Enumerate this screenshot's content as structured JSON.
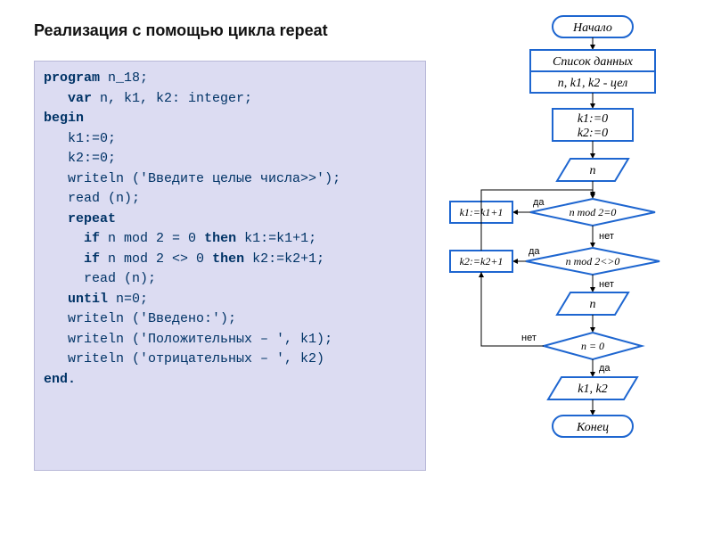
{
  "title": "Реализация с помощью цикла repeat",
  "code": {
    "l1a": "program",
    "l1b": " n_18;",
    "l2a": "   var",
    "l2b": " n, k1, k2: integer;",
    "l3": "begin",
    "l4": "   k1:=0;",
    "l5": "   k2:=0;",
    "l6": "   writeln ('Введите целые числа>>');",
    "l7": "   read (n);",
    "l8": "   repeat",
    "l9a": "     if",
    "l9b": " n mod 2 = 0 ",
    "l9c": "then",
    "l9d": " k1:=k1+1;",
    "l10a": "     if",
    "l10b": " n mod 2 <> 0 ",
    "l10c": "then",
    "l10d": " k2:=k2+1;",
    "l11": "     read (n);",
    "l12a": "   until",
    "l12b": " n=0;",
    "l13": "   writeln ('Введено:');",
    "l14": "   writeln ('Положительных – ', k1);",
    "l15": "   writeln ('отрицательных – ', k2)",
    "l16": "end."
  },
  "flow": {
    "start": "Начало",
    "datalist": "Список данных",
    "vars": "n, k1, k2 - цел",
    "init1": "k1:=0",
    "init2": "k2:=0",
    "read_n": "n",
    "cond1": "n mod 2=0",
    "act1": "k1:=k1+1",
    "cond2": "n mod 2<>0",
    "act2": "k2:=k2+1",
    "read_n2": "n",
    "cond3": "n = 0",
    "out": "k1, k2",
    "end": "Конец",
    "yes": "да",
    "no": "нет"
  }
}
